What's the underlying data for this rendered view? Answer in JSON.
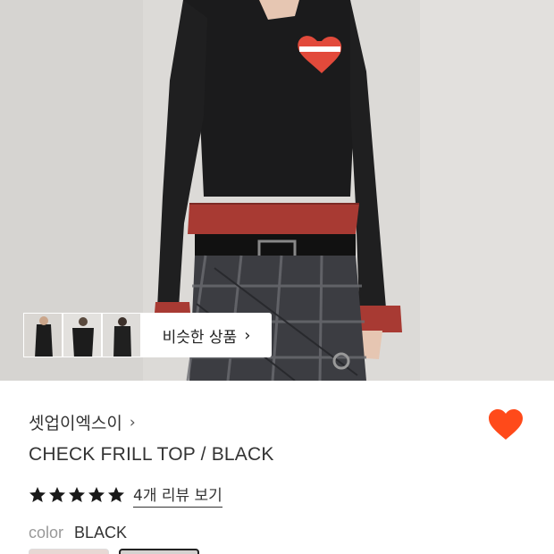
{
  "similar": {
    "label": "비슷한 상품",
    "thumb_count": 3
  },
  "product": {
    "brand": "셋업이엑스이",
    "title": "CHECK FRILL TOP / BLACK",
    "rating_stars": 5,
    "reviews_label": "4개 리뷰 보기",
    "liked": true
  },
  "options": {
    "color_label": "color",
    "color_value": "BLACK"
  },
  "colors": {
    "heart": "#ff4a1a",
    "star": "#1a1a1a"
  },
  "icons": {
    "brand_chevron": "chevron-right-icon",
    "similar_chevron": "chevron-right-icon",
    "like": "heart-icon",
    "rating": "star-icon"
  }
}
